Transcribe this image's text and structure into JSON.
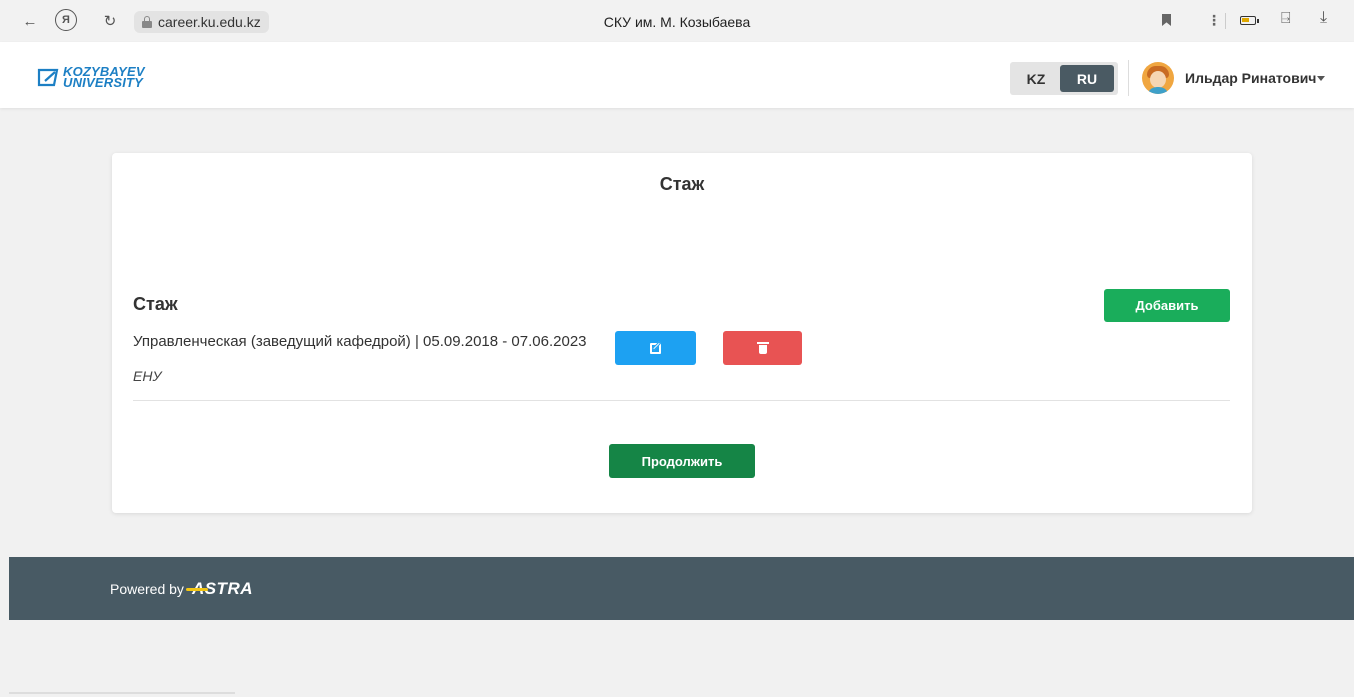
{
  "browser": {
    "url": "career.ku.edu.kz",
    "tab_title": "СКУ им. М. Козыбаева",
    "back_icon": "←",
    "reload_icon": "↻",
    "menu_icon": "⋮",
    "ext_icon": "⍈",
    "download_icon": "⤓",
    "ya_icon": "Я"
  },
  "header": {
    "logo_line1": "KOZYBAYEV",
    "logo_line2": "UNIVERSITY",
    "lang_kz": "KZ",
    "lang_ru": "RU",
    "active_lang": "RU",
    "user_name": "Ильдар Ринатович"
  },
  "card": {
    "title": "Стаж",
    "section_title": "Стаж",
    "add_label": "Добавить",
    "experience": {
      "line": "Управленческая (заведущий кафедрой) | 05.09.2018 - 07.06.2023",
      "organization": "ЕНУ"
    },
    "continue_label": "Продолжить"
  },
  "footer": {
    "powered_by": "Powered by",
    "brand": "ASTRA"
  },
  "colors": {
    "accent_green": "#1aad5b",
    "continue_green": "#158546",
    "edit_blue": "#1da1f2",
    "delete_red": "#e85353",
    "footer_bg": "#485a64",
    "logo_blue": "#1c7fc4"
  }
}
